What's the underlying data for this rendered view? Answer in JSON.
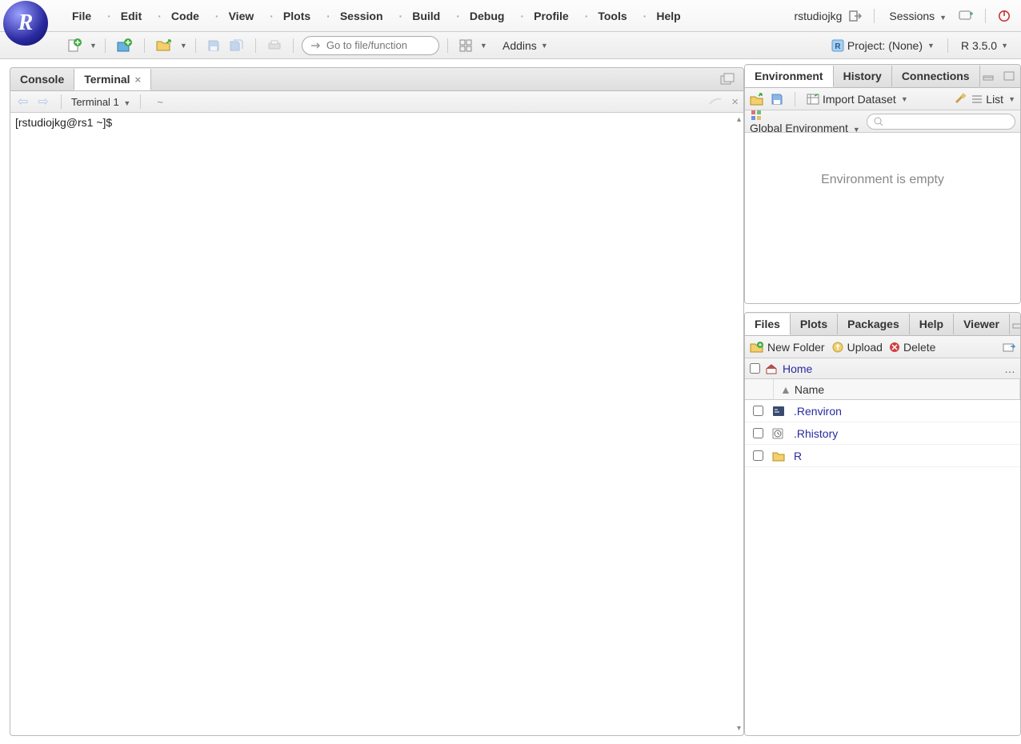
{
  "menubar": {
    "items": [
      "File",
      "Edit",
      "Code",
      "View",
      "Plots",
      "Session",
      "Build",
      "Debug",
      "Profile",
      "Tools",
      "Help"
    ],
    "user": "rstudiojkg",
    "sessions_label": "Sessions"
  },
  "toolbar": {
    "goto_placeholder": "Go to file/function",
    "addins_label": "Addins",
    "project_label": "Project: (None)",
    "r_version": "R 3.5.0"
  },
  "left_pane": {
    "tabs": [
      {
        "label": "Console",
        "active": false,
        "closable": false
      },
      {
        "label": "Terminal",
        "active": true,
        "closable": true
      }
    ],
    "terminal_selector": "Terminal 1",
    "path": "~",
    "prompt": "[rstudiojkg@rs1 ~]$"
  },
  "env_pane": {
    "tabs": [
      "Environment",
      "History",
      "Connections"
    ],
    "active_tab": "Environment",
    "import_label": "Import Dataset",
    "list_label": "List",
    "scope_label": "Global Environment",
    "empty_msg": "Environment is empty"
  },
  "files_pane": {
    "tabs": [
      "Files",
      "Plots",
      "Packages",
      "Help",
      "Viewer"
    ],
    "active_tab": "Files",
    "toolbar": {
      "new_folder": "New Folder",
      "upload": "Upload",
      "delete": "Delete"
    },
    "breadcrumb": "Home",
    "header": {
      "name_col": "Name"
    },
    "files": [
      {
        "icon": "file-env",
        "name": ".Renviron"
      },
      {
        "icon": "file-hist",
        "name": ".Rhistory"
      },
      {
        "icon": "folder",
        "name": "R"
      }
    ]
  }
}
